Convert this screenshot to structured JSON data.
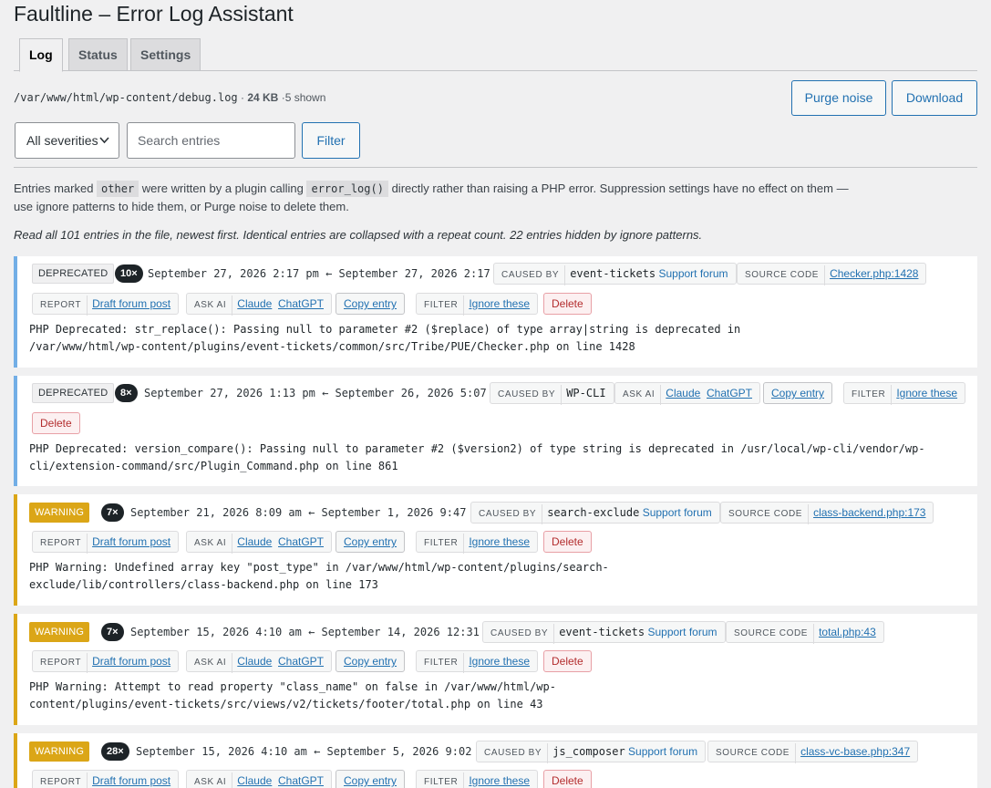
{
  "app": {
    "title": "Faultline – Error Log Assistant"
  },
  "tabs": [
    "Log",
    "Status",
    "Settings"
  ],
  "log": {
    "path": "/var/www/html/wp-content/debug.log",
    "size": "24 KB",
    "shown": "5 shown"
  },
  "actions": {
    "purge": "Purge noise",
    "download": "Download"
  },
  "filters": {
    "severity": "All severities",
    "search_placeholder": "Search entries",
    "filter_button": "Filter"
  },
  "note": {
    "p1": "Entries marked",
    "code1": "other",
    "p2": "were written by a plugin calling",
    "code2": "error_log()",
    "p3": "directly rather than raising a PHP error. Suppression settings have no effect on them — use ignore patterns to hide them, or Purge noise to delete them."
  },
  "summary": "Read all 101 entries in the file, newest first. Identical entries are collapsed with a repeat count. 22 entries hidden by ignore patterns.",
  "labels": {
    "report": "REPORT",
    "draft": "Draft forum post",
    "ask_ai": "ASK AI",
    "claude": "Claude",
    "chatgpt": "ChatGPT",
    "copy": "Copy entry",
    "filter": "FILTER",
    "ignore": "Ignore these",
    "delete": "Delete",
    "caused_by": "CAUSED BY",
    "support": "Support forum",
    "source_code": "SOURCE CODE"
  },
  "entries": [
    {
      "severity": "DEPRECATED",
      "count": "10×",
      "dates": "September 27, 2026 2:17 pm ← September 27, 2026 2:17 pm",
      "caused_by": "event-tickets",
      "source": "Checker.php:1428",
      "message": "PHP Deprecated: str_replace(): Passing null to parameter #2 ($replace) of type array|string is deprecated in\n/var/www/html/wp-content/plugins/event-tickets/common/src/Tribe/PUE/Checker.php on line 1428"
    },
    {
      "severity": "DEPRECATED",
      "count": "8×",
      "dates": "September 27, 2026 1:13 pm ← September 26, 2026 5:07 pm",
      "caused_by": "WP-CLI",
      "message": "PHP Deprecated: version_compare(): Passing null to parameter #2 ($version2) of type string is deprecated in /usr/local/wp-cli/vendor/wp-\ncli/extension-command/src/Plugin_Command.php on line 861"
    },
    {
      "severity": "WARNING",
      "count": "7×",
      "dates": "September 21, 2026 8:09 am ← September 1, 2026 9:47 am",
      "caused_by": "search-exclude",
      "source": "class-backend.php:173",
      "message": "PHP Warning: Undefined array key \"post_type\" in /var/www/html/wp-content/plugins/search-\nexclude/lib/controllers/class-backend.php on line 173"
    },
    {
      "severity": "WARNING",
      "count": "7×",
      "dates": "September 15, 2026 4:10 am ← September 14, 2026 12:31 pm",
      "caused_by": "event-tickets",
      "source": "total.php:43",
      "message": "PHP Warning: Attempt to read property \"class_name\" on false in /var/www/html/wp-\ncontent/plugins/event-tickets/src/views/v2/tickets/footer/total.php on line 43"
    },
    {
      "severity": "WARNING",
      "count": "28×",
      "dates": "September 15, 2026 4:10 am ← September 5, 2026 9:02 pm",
      "caused_by": "js_composer",
      "source": "class-vc-base.php:347"
    }
  ]
}
